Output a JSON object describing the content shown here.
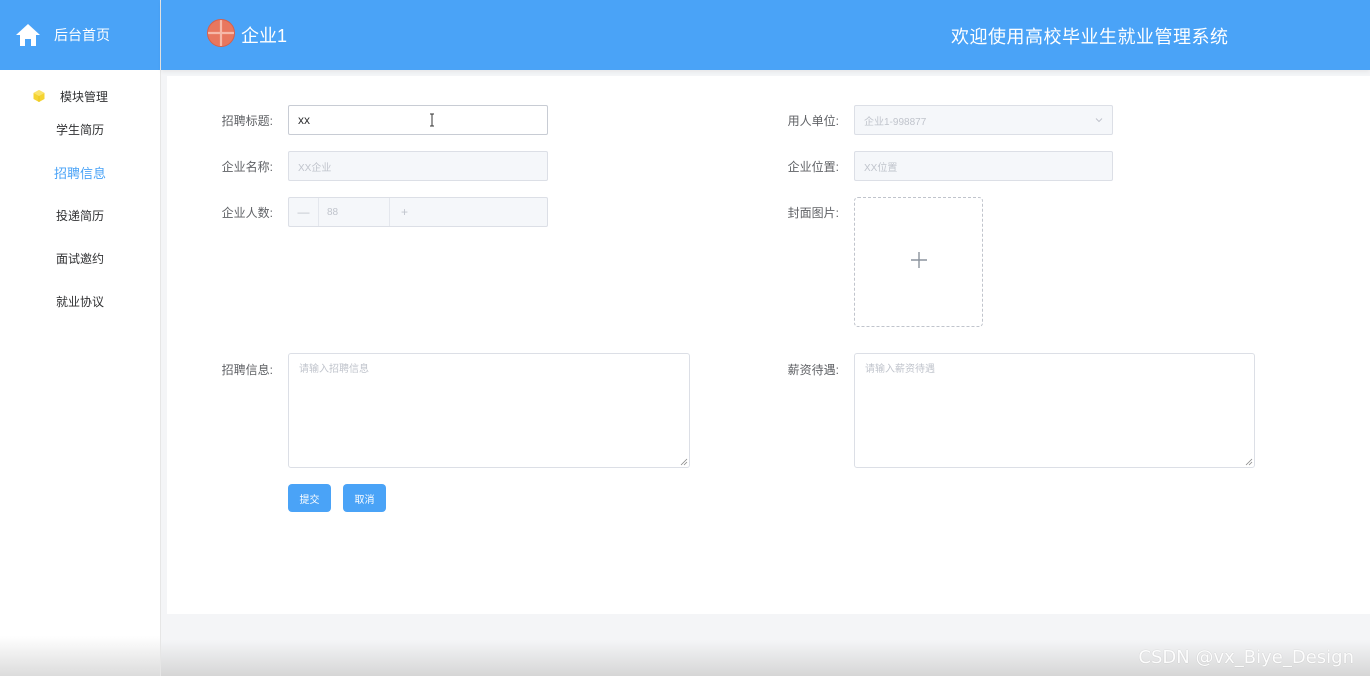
{
  "sidebar": {
    "home_label": "后台首页",
    "group_label": "模块管理",
    "items": [
      {
        "label": "学生简历",
        "active": false
      },
      {
        "label": "招聘信息",
        "active": true
      },
      {
        "label": "投递简历",
        "active": false
      },
      {
        "label": "面试邀约",
        "active": false
      },
      {
        "label": "就业协议",
        "active": false
      }
    ]
  },
  "header": {
    "company_name": "企业1",
    "system_title": "欢迎使用高校毕业生就业管理系统"
  },
  "form": {
    "title_label": "招聘标题:",
    "title_value": "xx",
    "unit_label": "用人单位:",
    "unit_value": "企业1-998877",
    "company_label": "企业名称:",
    "company_value": "XX企业",
    "location_label": "企业位置:",
    "location_value": "XX位置",
    "headcount_label": "企业人数:",
    "headcount_value": "88",
    "cover_label": "封面图片:",
    "info_label": "招聘信息:",
    "info_placeholder": "请输入招聘信息",
    "salary_label": "薪资待遇:",
    "salary_placeholder": "请输入薪资待遇",
    "submit_label": "提交",
    "cancel_label": "取消"
  },
  "watermark": "CSDN @vx_Biye_Design",
  "colors": {
    "primary": "#4aa3f7",
    "border": "#dcdfe6",
    "disabled_bg": "#f5f7fa"
  }
}
